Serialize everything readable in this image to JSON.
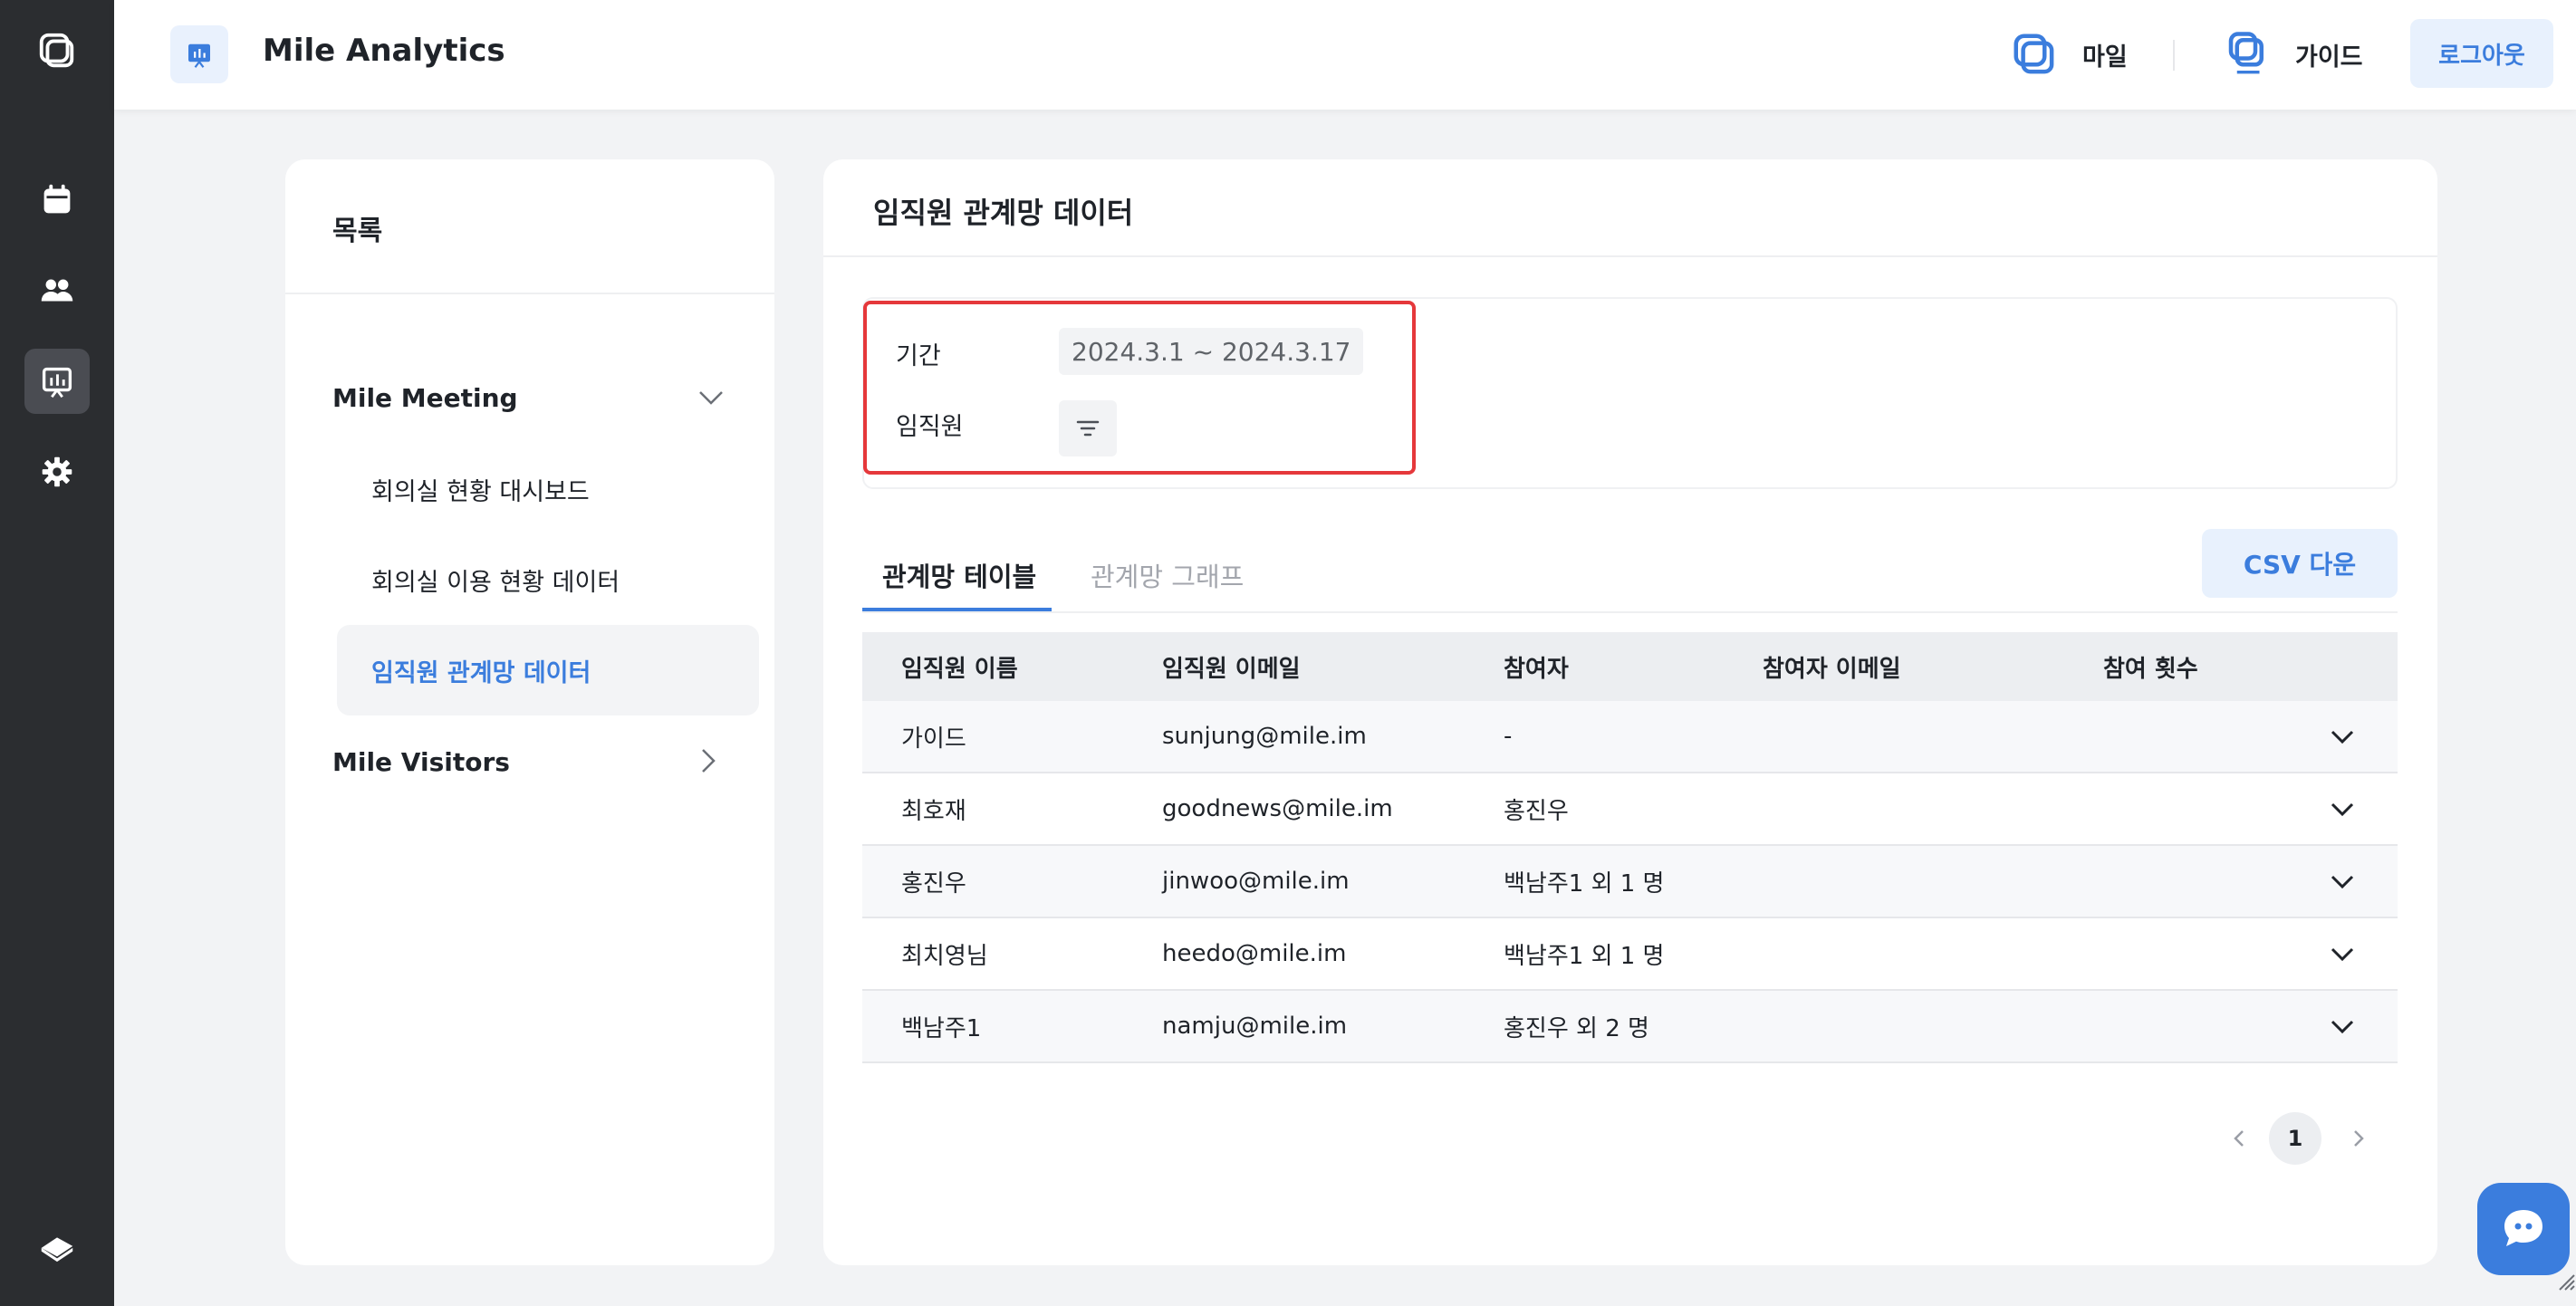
{
  "header": {
    "title": "Mile Analytics",
    "links": [
      {
        "label": "마일",
        "icon": "mile-logo-icon"
      },
      {
        "label": "가이드",
        "icon": "mile-visitors-logo-icon"
      }
    ],
    "logout_label": "로그아웃"
  },
  "rail": {
    "items": [
      "app-logo-icon",
      "calendar-icon",
      "users-icon",
      "analytics-icon",
      "settings-icon",
      "book-icon"
    ],
    "active": "analytics-icon"
  },
  "sidebar": {
    "title": "목록",
    "groups": [
      {
        "label": "Mile Meeting",
        "expanded": true,
        "items": [
          {
            "label": "회의실 현황 대시보드",
            "active": false
          },
          {
            "label": "회의실 이용 현황 데이터",
            "active": false
          },
          {
            "label": "임직원 관계망 데이터",
            "active": true
          }
        ]
      },
      {
        "label": "Mile Visitors",
        "expanded": false,
        "items": []
      }
    ]
  },
  "main": {
    "title": "임직원 관계망 데이터",
    "filters": {
      "period_label": "기간",
      "period_value": "2024.3.1 ~ 2024.3.17",
      "employee_label": "임직원"
    },
    "tabs": [
      {
        "label": "관계망 테이블",
        "active": true
      },
      {
        "label": "관계망 그래프",
        "active": false
      }
    ],
    "csv_label": "CSV 다운",
    "table": {
      "columns": [
        "임직원 이름",
        "임직원 이메일",
        "참여자",
        "참여자 이메일",
        "참여 횟수"
      ],
      "rows": [
        {
          "name": "가이드",
          "email": "sunjung@mile.im",
          "participant": "-",
          "participant_email": "",
          "count": ""
        },
        {
          "name": "최호재",
          "email": "goodnews@mile.im",
          "participant": "홍진우",
          "participant_email": "",
          "count": ""
        },
        {
          "name": "홍진우",
          "email": "jinwoo@mile.im",
          "participant": "백남주1 외 1 명",
          "participant_email": "",
          "count": ""
        },
        {
          "name": "최치영님",
          "email": "heedo@mile.im",
          "participant": "백남주1 외 1 명",
          "participant_email": "",
          "count": ""
        },
        {
          "name": "백남주1",
          "email": "namju@mile.im",
          "participant": "홍진우 외 2 명",
          "participant_email": "",
          "count": ""
        }
      ]
    },
    "pagination": {
      "current": "1"
    }
  },
  "colors": {
    "accent": "#3b7ddd",
    "rail_bg": "#2b2d30",
    "highlight_border": "#e5383b",
    "page_bg": "#f2f3f5"
  }
}
